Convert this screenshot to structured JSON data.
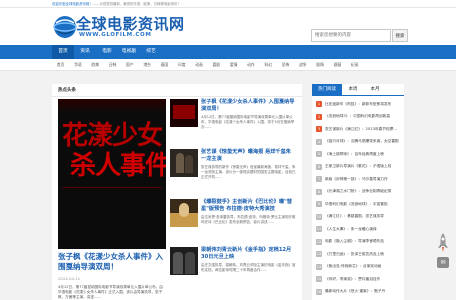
{
  "topbar": {
    "welcome": "欢迎光临全球电影资讯网！",
    "text": "——为您提供最新、最快的华语、欧美、日韩等电影资讯！"
  },
  "brand": {
    "name_cn": "全球电影资讯网",
    "name_en": "WWW.GLOFILM.COM",
    "accent_color": "#1a6fc4"
  },
  "search": {
    "placeholder": "搜索您想要的内容",
    "button": "搜索"
  },
  "nav": {
    "items": [
      "首页",
      "资讯",
      "电影",
      "电视剧",
      "综艺"
    ]
  },
  "subnav": {
    "items": [
      "首页",
      "华语",
      "欧美",
      "日韩",
      "国产",
      "港台",
      "泰国",
      "印度",
      "动画",
      "喜剧",
      "爱情",
      "动作",
      "科幻",
      "恐怖",
      "战争",
      "剧情",
      "悬疑",
      "纪录"
    ]
  },
  "main": {
    "section_title": "热点头条",
    "lead": {
      "poster_text_1": "花漾少女",
      "poster_text_2": "杀人事件",
      "title": "张子枫《花漾少女杀人事件》入围戛纳导演双周！",
      "date": "2024-04-12",
      "desc": "4月12日，第77届戛纳国际电影节导演双周单元入围片单公布，由华语电影《花漾少女杀人事件》正式入围。该片由导演执导，张子枫、万茜等主演，讲述......"
    },
    "articles": [
      {
        "title": "张子枫《花漾少女杀人事件》入围戛纳导演双周！",
        "desc": "4月12日，第77届戛纳国际电影节导演双周单元入围片单公布，华语电影《花漾少女杀人事件》入围，将于5月在戛纳举办......"
      },
      {
        "title": "张艺谋《惊蛰无声》曝海报 易烊千玺朱一龙主演",
        "desc": "张艺谋执导的新作《惊蛰无声》官宣最新海报，易烊千玺、朱一龙领衔主演，该片为一部现实题材的国安主题电影，目前已正式开机......"
      },
      {
        "title": "《爆裂鼓手》主创新片《巴比伦》曝\"彗星\"版预告 布拉德·皮特大秀演技",
        "desc": "由达米恩·查泽雷执导，布拉德·皮特、玛格特·罗比主演的好莱坞史诗《巴比伦》发布全新预告，影片讲述......"
      },
      {
        "title": "梁朝伟刘青云新片《金手指》定档12月30日元旦上映",
        "desc": "由庄文强执导，梁朝伟、刘青云领衔主演的电影《金手指》宣布定档，两位影帝时隔二十年再度合作......"
      }
    ]
  },
  "sidebar": {
    "tabs": [
      "热门阅读",
      "本周",
      "本月"
    ],
    "items": [
      "比亚迪新车《阿兹》：新款车型即将发布",
      "《流浪地球3》：中国科幻电影再创新高",
      "张艺谋新片《满江红》：2023年春节档票房冠军",
      "《独行月球》：沈腾马丽爆笑来袭，太空喜剧",
      "《海上钢琴师》：百年经典再度上映",
      "王家卫新片导演片《繁花》：沪语版上线",
      "新版《封神第一部》：乌尔善导演力作",
      "《长津湖之水门桥》：战争巨制再破纪录",
      "华语科幻电影《流浪地球》：宇宙冒险",
      "《满江红》：悬疑喜剧，张艺谋执导",
      "《人生大事》：朱一龙暖心演绎",
      "电影《隐入尘烟》：导演李睿珺作品",
      "《万里归途》：张译王俊凯热血上映",
      "《熊出没·伴我熊芯》：合家欢动画",
      "《你好，李焕英》：贾玲催泪佳作",
      "最新动作大片《怒火·重案》：甄子丹",
      "《我和我的父辈》：吴京执导篇章"
    ]
  }
}
